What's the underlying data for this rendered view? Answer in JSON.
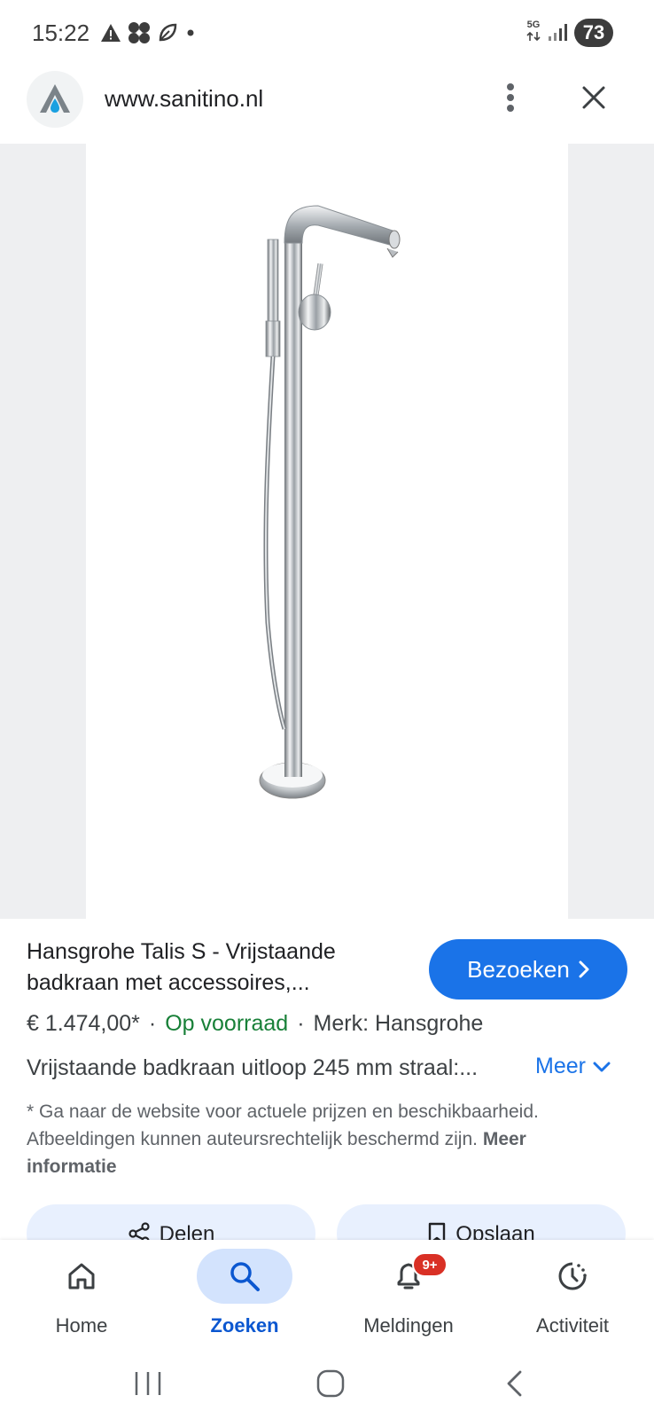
{
  "status_bar": {
    "time": "15:22",
    "network": "5G",
    "battery": "73"
  },
  "browser": {
    "url": "www.sanitino.nl"
  },
  "product": {
    "title": "Hansgrohe Talis S - Vrijstaande badkraan met accessoires,...",
    "visit_label": "Bezoeken",
    "price": "€ 1.474,00*",
    "stock": "Op voorraad",
    "brand": "Merk: Hansgrohe",
    "description": "Vrijstaande badkraan uitloop 245 mm straal:...",
    "more_label": "Meer",
    "disclaimer": "* Ga naar de website voor actuele prijzen en beschikbaarheid. Afbeeldingen kunnen auteursrechtelijk beschermd zijn.",
    "more_info_label": "Meer informatie",
    "share_label": "Delen",
    "save_label": "Opslaan"
  },
  "bottom_nav": {
    "items": [
      {
        "label": "Home",
        "icon": "home-icon"
      },
      {
        "label": "Zoeken",
        "icon": "search-icon",
        "active": true
      },
      {
        "label": "Meldingen",
        "icon": "bell-icon",
        "badge": "9+"
      },
      {
        "label": "Activiteit",
        "icon": "activity-icon"
      }
    ]
  },
  "colors": {
    "accent": "#1a73e8",
    "stock_green": "#188038",
    "badge_red": "#d93025",
    "active_nav_bg": "#d3e3fd"
  }
}
